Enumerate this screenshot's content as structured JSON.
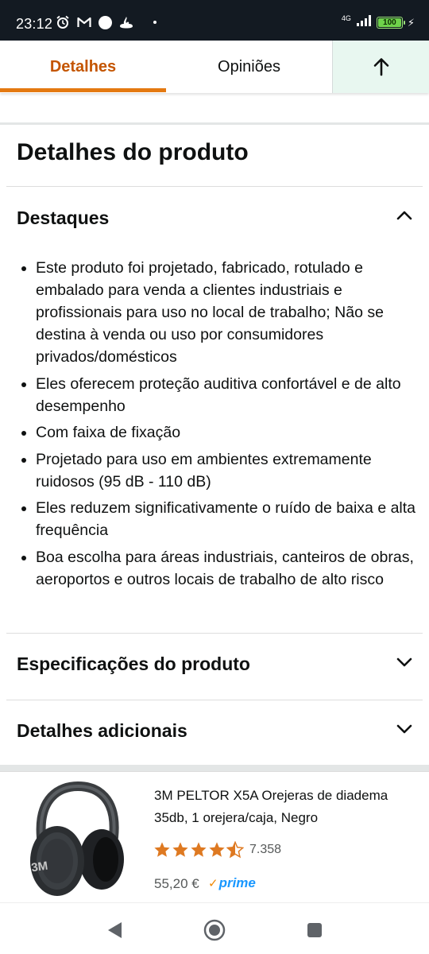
{
  "status_bar": {
    "time": "23:12",
    "network": "4G",
    "battery": "100",
    "battery_level_percent": 100,
    "icons": [
      "alarm-icon",
      "gmail-icon",
      "circle-icon",
      "santander-icon",
      "dot-icon",
      "signal-icon",
      "battery-icon",
      "charging-icon"
    ]
  },
  "tabs": {
    "details_label": "Detalhes",
    "reviews_label": "Opiniões",
    "up_icon": "arrow-up-icon",
    "active": "details"
  },
  "section": {
    "title": "Detalhes do produto"
  },
  "highlights": {
    "title": "Destaques",
    "expanded": true,
    "items": [
      "Este produto foi projetado, fabricado, rotulado e embalado para venda a clientes industriais e profissionais para uso no local de trabalho; Não se destina à venda ou uso por consumidores privados/domésticos",
      "Eles oferecem proteção auditiva confortável e de alto desempenho",
      "Com faixa de fixação",
      "Projetado para uso em ambientes extremamente ruidosos (95 dB - 110 dB)",
      "Eles reduzem significativamente o ruído de baixa e alta frequência",
      "Boa escolha para áreas industriais, canteiros de obras, aeroportos e outros locais de trabalho de alto risco"
    ]
  },
  "specs": {
    "title": "Especificações do produto",
    "expanded": false
  },
  "additional": {
    "title": "Detalhes adicionais",
    "expanded": false
  },
  "product_card": {
    "title": "3M PELTOR X5A Orejeras de diadema 35db, 1 orejera/caja, Negro",
    "rating_stars": 4.5,
    "rating_count": "7.358",
    "price": "55,20 €",
    "prime_label": "prime",
    "image_logo": "3M"
  },
  "colors": {
    "active_tab": "#c45500",
    "tab_underline": "#e47911",
    "up_button_bg": "#e8f7f0",
    "star": "#de7921",
    "prime": "#1a98ff",
    "status_bar_bg": "#131a22"
  }
}
